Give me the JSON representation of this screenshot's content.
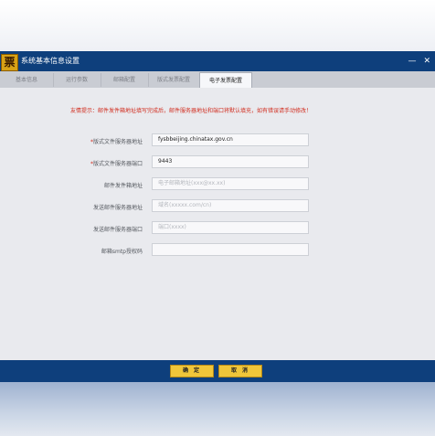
{
  "app": {
    "icon_glyph": "票",
    "title": "系统基本信息设置",
    "minimize": "—",
    "close": "✕"
  },
  "tabs": [
    {
      "label": "基本信息"
    },
    {
      "label": "运行参数"
    },
    {
      "label": "邮箱配置"
    },
    {
      "label": "版式发票配置"
    },
    {
      "label": "电子发票配置"
    }
  ],
  "hint": "友情提示：邮件发件箱地址填写完成后，邮件服务器地址和端口将默认填充，如有错误请手动修改！",
  "form": {
    "rows": [
      {
        "label": "版式文件服务器地址",
        "required": "*",
        "value": "fysbbeijing.chinatax.gov.cn"
      },
      {
        "label": "版式文件服务器端口",
        "required": "*",
        "value": "9443"
      },
      {
        "label": "邮件发件箱地址",
        "required": "",
        "value": "",
        "placeholder": "电子邮箱地址(xxx@xx.xx)"
      },
      {
        "label": "发送邮件服务器地址",
        "required": "",
        "value": "",
        "placeholder": "域名(xxxxx.com/cn)"
      },
      {
        "label": "发送邮件服务器端口",
        "required": "",
        "value": "",
        "placeholder": "端口(xxxx)"
      },
      {
        "label": "邮箱smtp授权码",
        "required": "",
        "value": "",
        "placeholder": ""
      }
    ]
  },
  "footer": {
    "confirm": "确 定",
    "cancel": "取 消"
  },
  "colors": {
    "titlebar": "#0e3f7c",
    "accent_button": "#f0c63a",
    "hint_text": "#d12c1e"
  }
}
